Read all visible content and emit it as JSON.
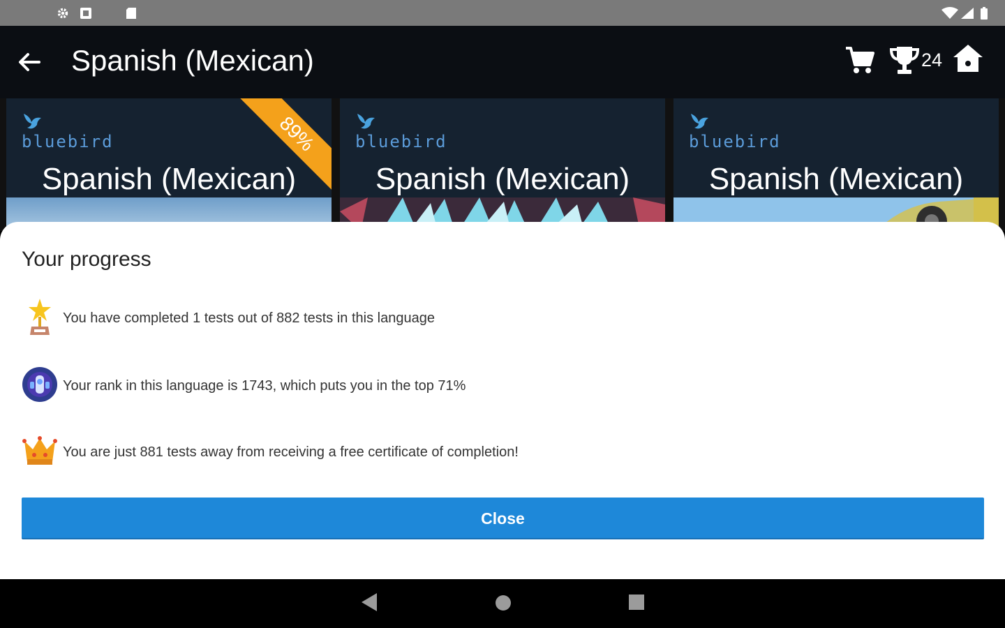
{
  "app_bar": {
    "title": "Spanish (Mexican)",
    "trophy_count": "24"
  },
  "cards": [
    {
      "brand": "bluebird",
      "title": "Spanish (Mexican)",
      "ribbon": "89%"
    },
    {
      "brand": "bluebird",
      "title": "Spanish (Mexican)"
    },
    {
      "brand": "bluebird",
      "title": "Spanish (Mexican)"
    }
  ],
  "dialog": {
    "title": "Your progress",
    "rows": [
      {
        "icon": "award-star-icon",
        "text": "You have completed 1 tests out of 882 tests in this language"
      },
      {
        "icon": "rank-badge-icon",
        "text": "Your rank in this language is 1743, which puts you in the top 71%"
      },
      {
        "icon": "crown-icon",
        "text": "You are just 881 tests away from receiving a free certificate of completion!"
      }
    ],
    "close_label": "Close"
  },
  "colors": {
    "accent": "#1e88d9",
    "ribbon": "#f4a11b",
    "app_bar": "#0b0e13",
    "card_bg": "#152230"
  }
}
